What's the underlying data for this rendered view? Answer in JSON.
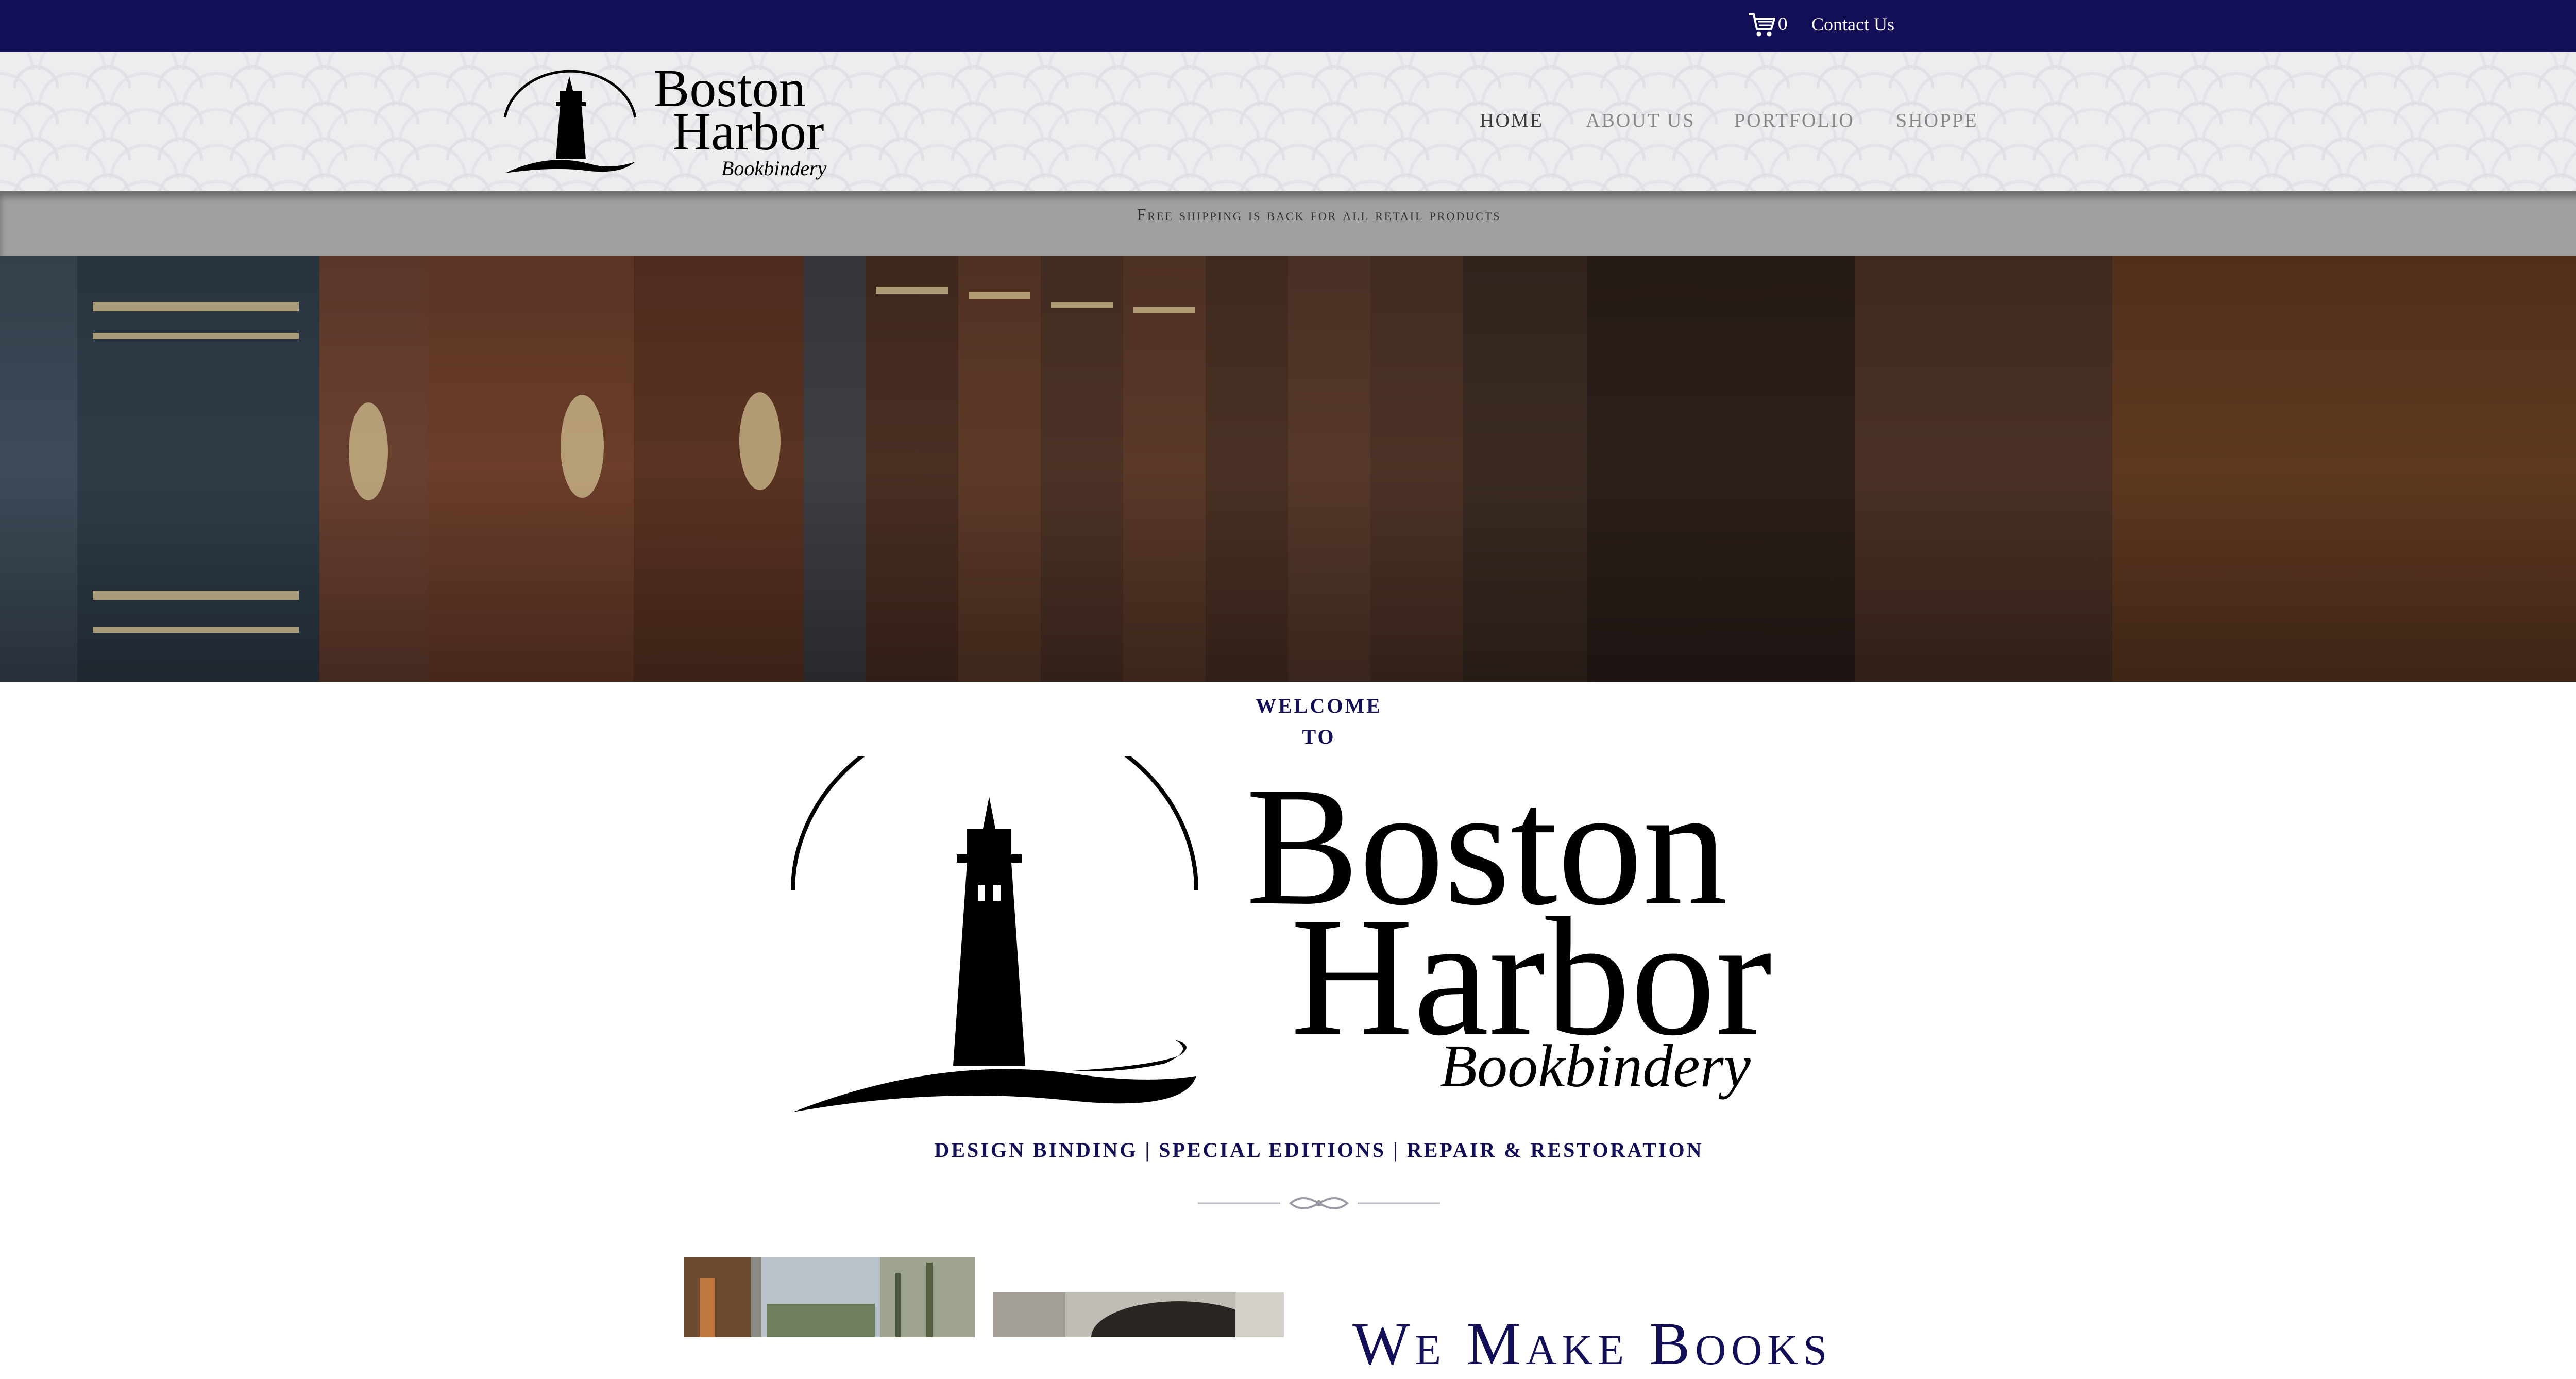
{
  "topbar": {
    "cart_icon": "shopping-cart-icon",
    "cart_count": "0",
    "contact_label": "Contact Us"
  },
  "header": {
    "logo_line1": "Boston",
    "logo_line2": "Harbor",
    "logo_line3": "Bookbindery",
    "nav": [
      {
        "label": "HOME",
        "active": true
      },
      {
        "label": "ABOUT US",
        "active": false
      },
      {
        "label": "PORTFOLIO",
        "active": false
      },
      {
        "label": "SHOPPE",
        "active": false
      }
    ]
  },
  "banner": {
    "text": "Free shipping is back for all retail products"
  },
  "welcome": {
    "line1": "WELCOME",
    "line2": "TO",
    "logo_line1": "Boston",
    "logo_line2": "Harbor",
    "logo_line3": "Bookbindery",
    "tagline": "DESIGN BINDING | SPECIAL EDITIONS | REPAIR & RESTORATION"
  },
  "bottom": {
    "heading": "We Make Books"
  },
  "colors": {
    "navy": "#120f57",
    "banner_gray": "#a0a0a0",
    "header_bg": "#ededf0"
  }
}
